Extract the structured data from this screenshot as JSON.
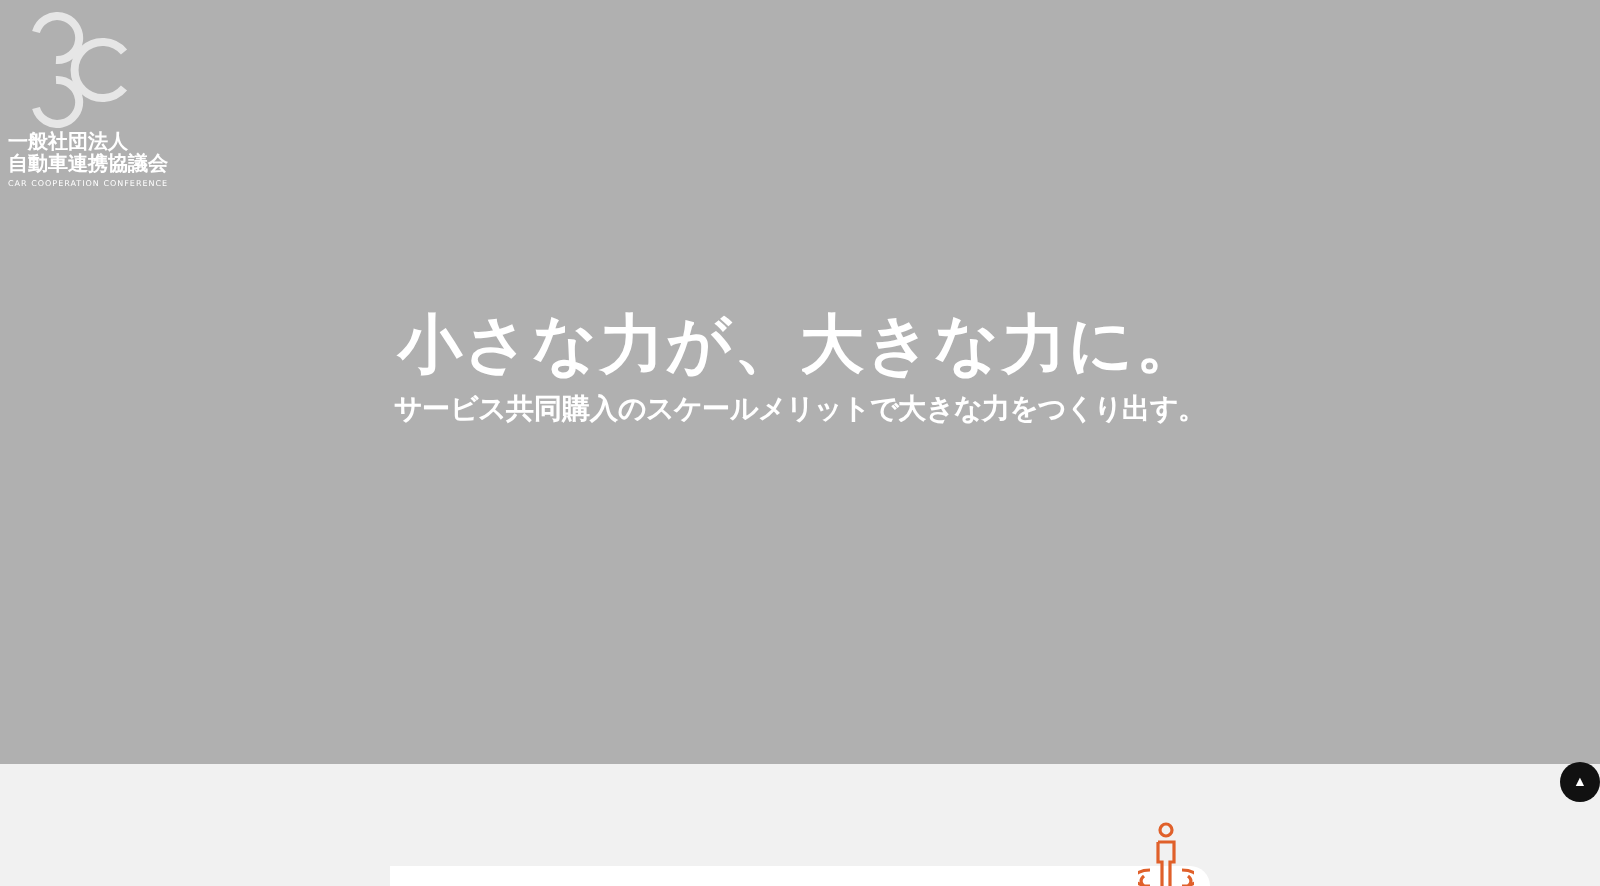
{
  "logo": {
    "org_type": "一般社団法人",
    "name": "自動車連携協議会",
    "name_en": "CAR COOPERATION CONFERENCE"
  },
  "hero": {
    "headline": "小さな力が、大きな力に。",
    "subline": "サービス共同購入のスケールメリットで大きな力をつくり出す。"
  },
  "back_to_top": {
    "symbol": "▲"
  }
}
